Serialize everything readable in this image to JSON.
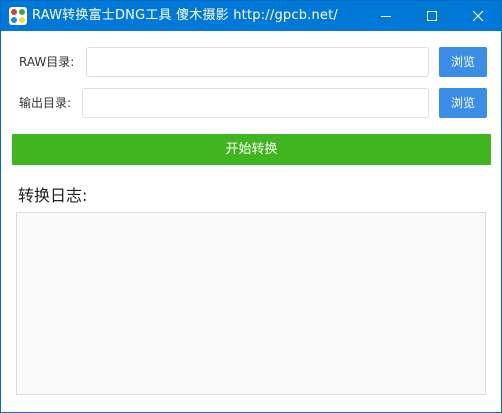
{
  "window": {
    "title": "RAW转换富士DNG工具  傻木摄影  http://gpcb.net/",
    "icon": "app-logo-icon",
    "controls": {
      "minimize_icon": "minimize-icon",
      "maximize_icon": "maximize-icon",
      "close_icon": "close-icon"
    }
  },
  "colors": {
    "titlebar": "#0078d7",
    "browse_button": "#3a8ee6",
    "start_button": "#3fb51f"
  },
  "form": {
    "raw_dir": {
      "label": "RAW目录:",
      "value": "",
      "button_label": "浏览"
    },
    "output_dir": {
      "label": "输出目录:",
      "value": "",
      "button_label": "浏览"
    },
    "start_button_label": "开始转换"
  },
  "log": {
    "title": "转换日志:",
    "content": ""
  }
}
